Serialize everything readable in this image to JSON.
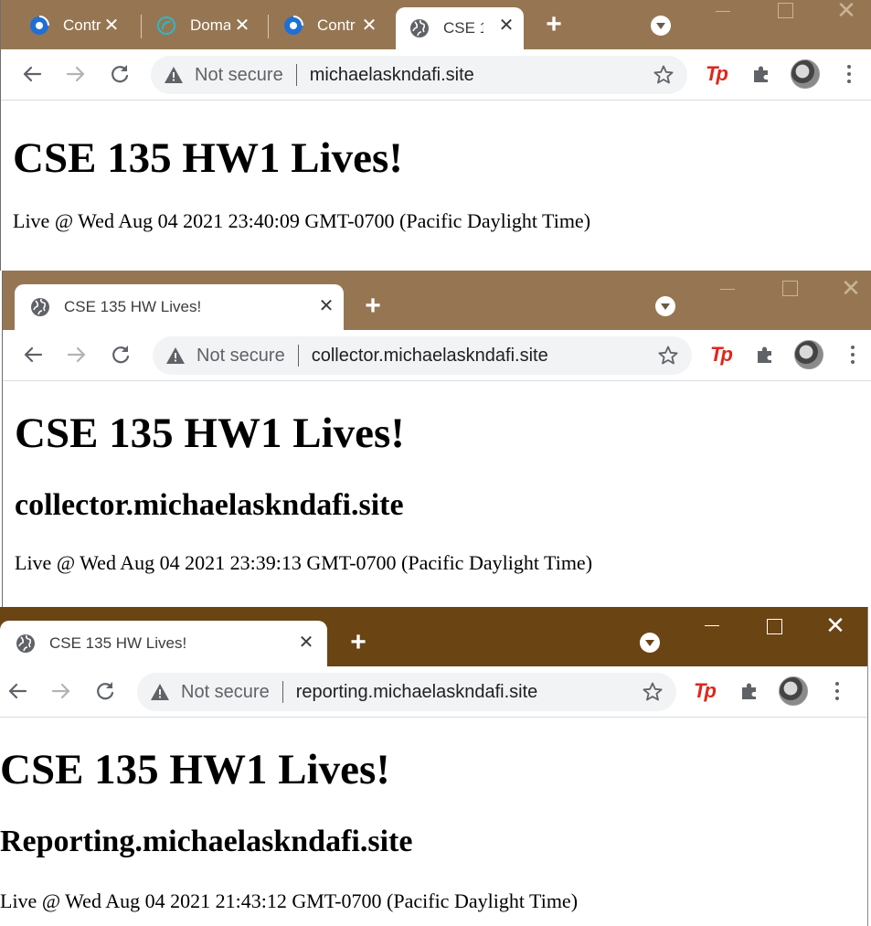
{
  "windows": [
    {
      "tabs": [
        {
          "title": "Contr",
          "icon": "cloudflare-icon"
        },
        {
          "title": "Doma",
          "icon": "digitalocean-icon"
        },
        {
          "title": "Contr",
          "icon": "cloudflare-icon"
        },
        {
          "title": "CSE 1",
          "icon": "globe-icon",
          "active": true
        }
      ],
      "omnibox": {
        "security_label": "Not secure",
        "url": "michaelaskndafi.site"
      },
      "page": {
        "heading": "CSE 135 HW1 Lives!",
        "subheading": "",
        "live_text": "Live @ Wed Aug 04 2021 23:40:09 GMT-0700 (Pacific Daylight Time)"
      }
    },
    {
      "tabs": [
        {
          "title": "CSE 135 HW Lives!",
          "icon": "globe-icon",
          "active": true
        }
      ],
      "omnibox": {
        "security_label": "Not secure",
        "url": "collector.michaelaskndafi.site"
      },
      "page": {
        "heading": "CSE 135 HW1 Lives!",
        "subheading": "collector.michaelaskndafi.site",
        "live_text": "Live @ Wed Aug 04 2021 23:39:13 GMT-0700 (Pacific Daylight Time)"
      }
    },
    {
      "tabs": [
        {
          "title": "CSE 135 HW Lives!",
          "icon": "globe-icon",
          "active": true
        }
      ],
      "omnibox": {
        "security_label": "Not secure",
        "url": "reporting.michaelaskndafi.site"
      },
      "page": {
        "heading": "CSE 135 HW1 Lives!",
        "subheading": "Reporting.michaelaskndafi.site",
        "live_text": "Live @ Wed Aug 04 2021 21:43:12 GMT-0700 (Pacific Daylight Time)"
      }
    }
  ],
  "colors": {
    "frame_inactive": "#967652",
    "frame_active": "#6b4414",
    "tp_extension": "#e0261b"
  }
}
